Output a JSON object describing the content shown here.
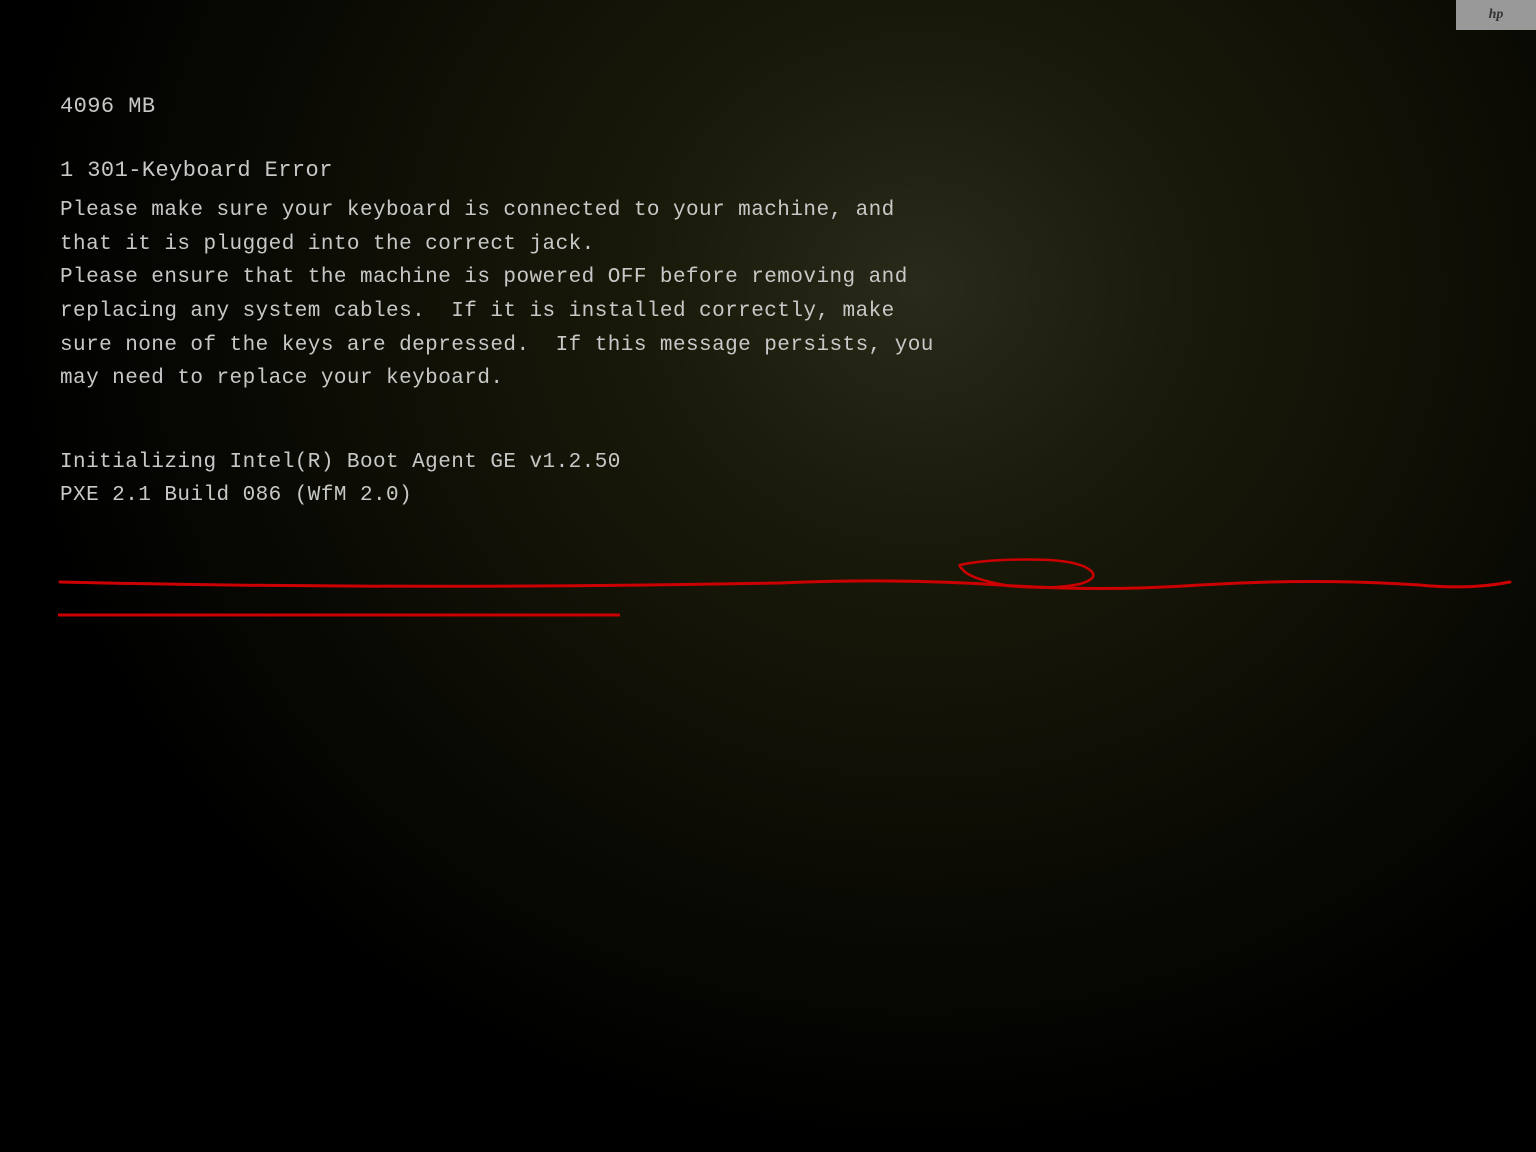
{
  "screen": {
    "hp_logo": "hp",
    "memory_line": "4096 MB",
    "error_code": "1 301-Keyboard Error",
    "error_messages": [
      "Please make sure your keyboard is connected to your machine, and",
      "that it is plugged into the correct jack.",
      "Please ensure that the machine is powered OFF before removing and",
      "replacing any system cables.  If it is installed correctly, make",
      "sure none of the keys are depressed.  If this message persists, you",
      "may need to replace your keyboard."
    ],
    "boot_lines": [
      "Initializing Intel(R) Boot Agent GE v1.2.50",
      "PXE 2.1 Build 086 (WfM 2.0)"
    ]
  }
}
